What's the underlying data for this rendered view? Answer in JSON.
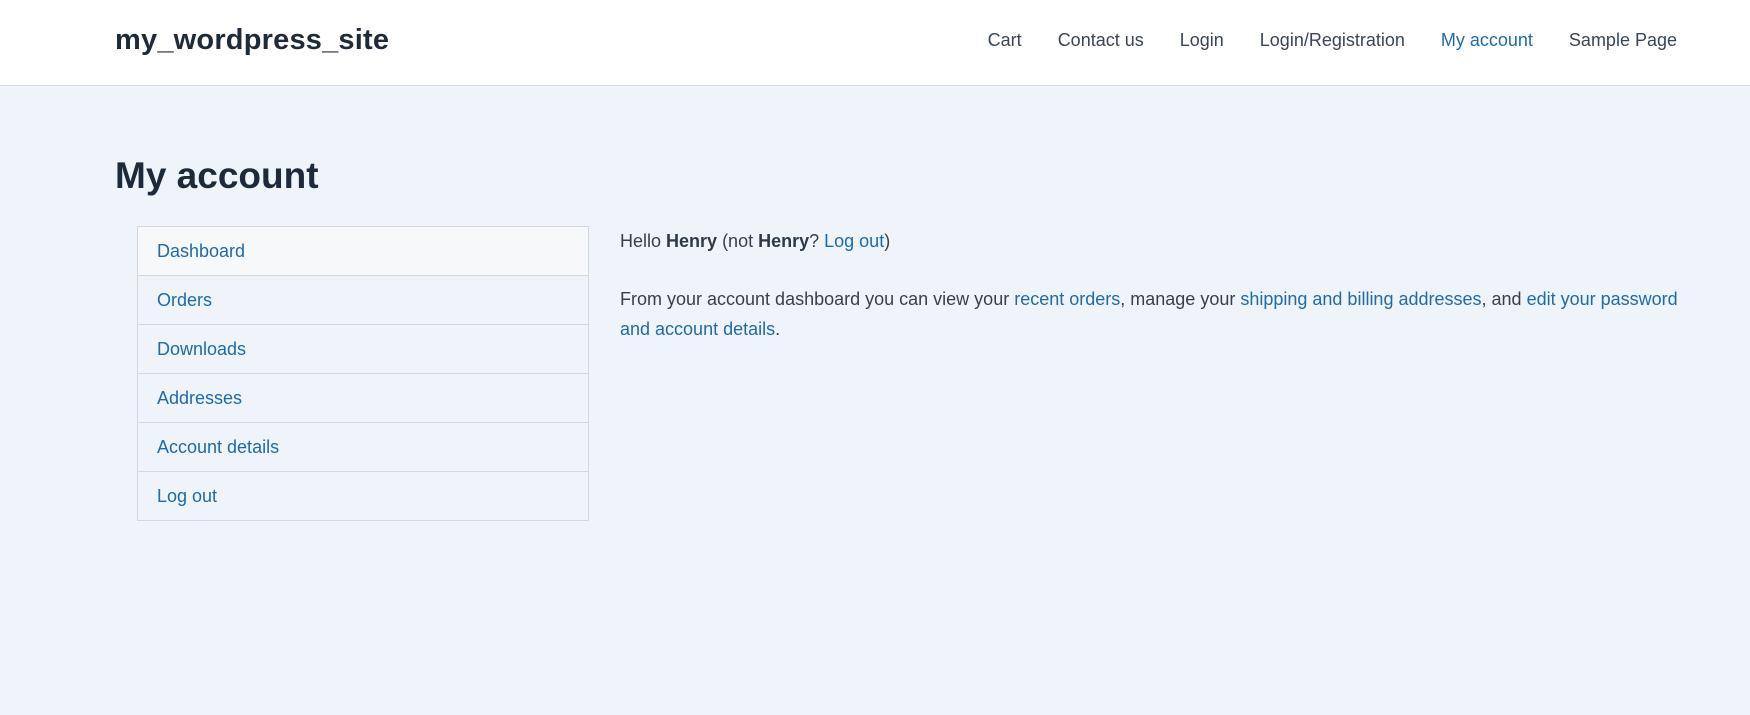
{
  "header": {
    "site_title": "my_wordpress_site",
    "nav": [
      {
        "label": "Cart"
      },
      {
        "label": "Contact us"
      },
      {
        "label": "Login"
      },
      {
        "label": "Login/Registration"
      },
      {
        "label": "My account",
        "active": true
      },
      {
        "label": "Sample Page"
      }
    ]
  },
  "page": {
    "title": "My account"
  },
  "account_nav": {
    "items": [
      {
        "label": "Dashboard",
        "selected": true
      },
      {
        "label": "Orders"
      },
      {
        "label": "Downloads"
      },
      {
        "label": "Addresses"
      },
      {
        "label": "Account details"
      },
      {
        "label": "Log out"
      }
    ]
  },
  "dashboard": {
    "greeting": {
      "hello": "Hello ",
      "username": "Henry",
      "not_prefix": " (not ",
      "username_repeat": "Henry",
      "question": "? ",
      "logout_link": "Log out",
      "close_paren": ")"
    },
    "description": {
      "part1": "From your account dashboard you can view your ",
      "link_orders": "recent orders",
      "part2": ", manage your ",
      "link_addresses": "shipping and billing addresses",
      "part3": ", and ",
      "link_account": "edit your password and account details",
      "part4": "."
    }
  },
  "colors": {
    "link": "#1f6aa9",
    "background": "#eef4fa",
    "header_bg": "#ffffff",
    "heading": "#1d2a3b"
  }
}
